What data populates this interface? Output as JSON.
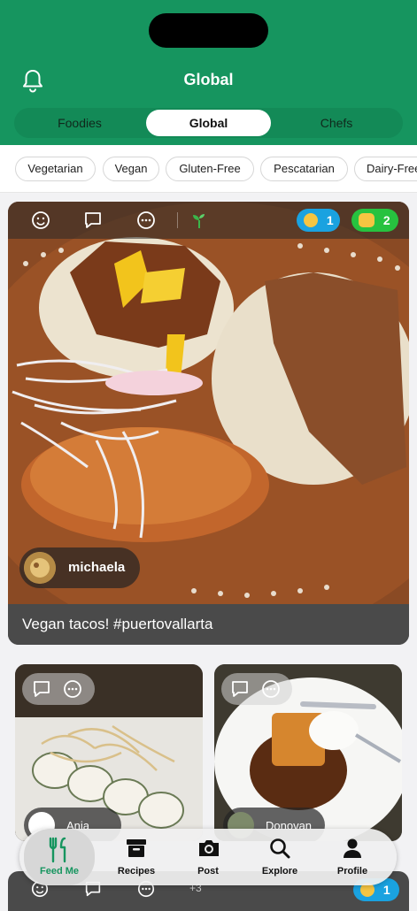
{
  "header": {
    "title": "Global",
    "tabs": [
      {
        "label": "Foodies",
        "active": false
      },
      {
        "label": "Global",
        "active": true
      },
      {
        "label": "Chefs",
        "active": false
      }
    ],
    "bg_color": "#16955f"
  },
  "filters": [
    "Vegetarian",
    "Vegan",
    "Gluten-Free",
    "Pescatarian",
    "Dairy-Free"
  ],
  "feed": {
    "main_post": {
      "reactions": [
        {
          "icon": "relieved-face-icon",
          "count": "1",
          "color": "#1aa2e0"
        },
        {
          "icon": "clapping-hands-icon",
          "count": "2",
          "color": "#27c23f"
        }
      ],
      "username": "michaela",
      "caption": "Vegan tacos! #puertovallarta"
    },
    "small_posts": [
      {
        "username": "Ania"
      },
      {
        "username": "Donovan"
      }
    ],
    "next_post": {
      "extra_count": "+3",
      "reaction_count": "1"
    }
  },
  "tabbar": [
    {
      "label": "Feed Me",
      "icon": "fork-knife-icon",
      "active": true
    },
    {
      "label": "Recipes",
      "icon": "archive-box-icon",
      "active": false
    },
    {
      "label": "Post",
      "icon": "camera-icon",
      "active": false
    },
    {
      "label": "Explore",
      "icon": "magnifier-icon",
      "active": false
    },
    {
      "label": "Profile",
      "icon": "person-icon",
      "active": false
    }
  ]
}
